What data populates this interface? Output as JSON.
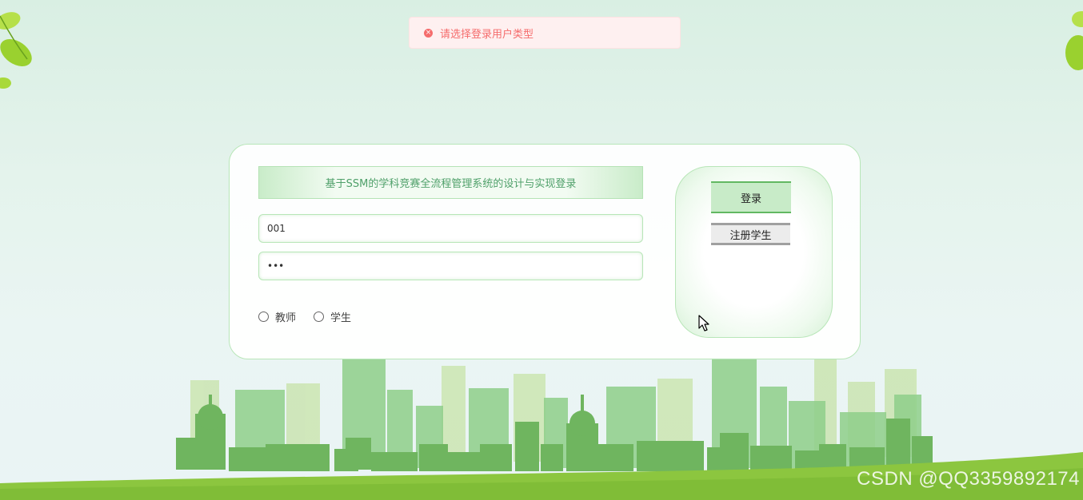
{
  "toast": {
    "icon": "close-circle-icon",
    "message": "请选择登录用户类型",
    "color": "#f56c6c"
  },
  "login": {
    "title": "基于SSM的学科竞赛全流程管理系统的设计与实现登录",
    "username_value": "001",
    "password_value": "123",
    "roles": [
      {
        "label": "教师",
        "checked": false
      },
      {
        "label": "学生",
        "checked": false
      }
    ],
    "login_button": "登录",
    "register_button": "注册学生"
  },
  "watermark": "CSDN @QQ3359892174",
  "colors": {
    "accent_green": "#62b862",
    "title_text": "#4fa06a",
    "grass": "#8cc63f"
  }
}
